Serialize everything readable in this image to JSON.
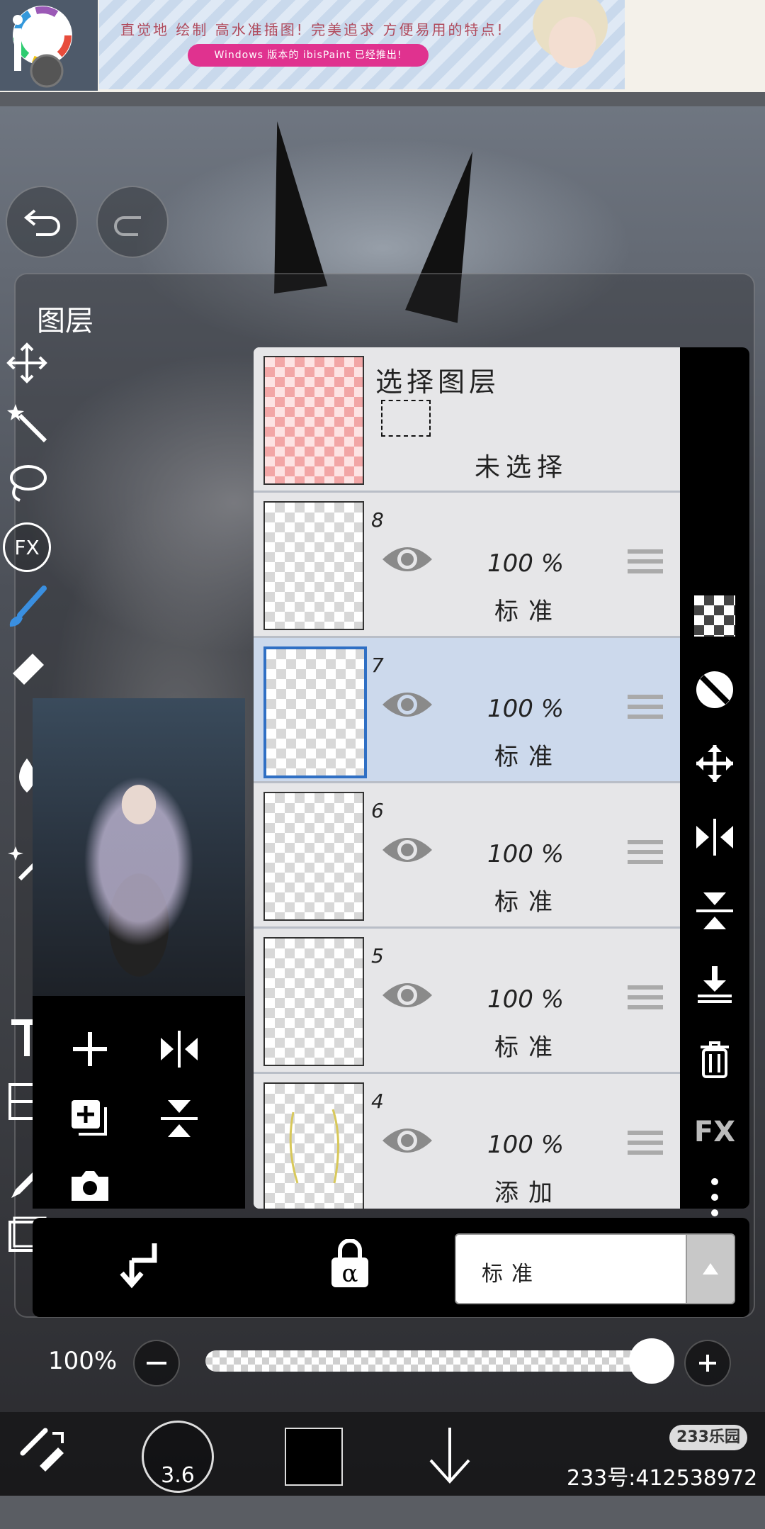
{
  "ad": {
    "headline": "直觉地 绘制 高水准插图! 完美追求 方便易用的特点!",
    "pill": "Windows 版本的 ibisPaint 已经推出!"
  },
  "panel": {
    "title": "图层"
  },
  "layers": [
    {
      "num": "",
      "name": "选择图层",
      "status": "未选择",
      "selected": false
    },
    {
      "num": "8",
      "opacity": "100 %",
      "mode": "标准",
      "selected": false
    },
    {
      "num": "7",
      "opacity": "100 %",
      "mode": "标准",
      "selected": true
    },
    {
      "num": "6",
      "opacity": "100 %",
      "mode": "标准",
      "selected": false
    },
    {
      "num": "5",
      "opacity": "100 %",
      "mode": "标准",
      "selected": false
    },
    {
      "num": "4",
      "opacity": "100 %",
      "mode": "添加",
      "selected": false
    }
  ],
  "right_strip": {
    "fx_label": "FX"
  },
  "left_strip": {
    "fx_label": "FX"
  },
  "blend_mode": {
    "value": "标准"
  },
  "opacity": {
    "label": "100%",
    "value_fraction": 1.0
  },
  "toolbar": {
    "brush_size": "3.6"
  },
  "watermark": {
    "badge": "233乐园",
    "id": "233号:412538972"
  }
}
